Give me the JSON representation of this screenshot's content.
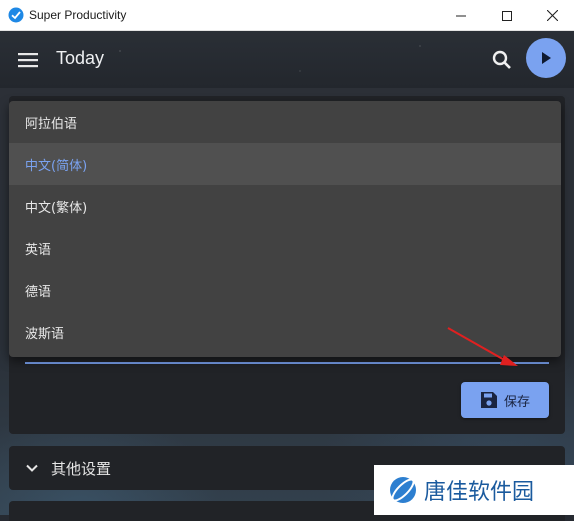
{
  "window": {
    "title": "Super Productivity"
  },
  "header": {
    "title": "Today"
  },
  "language_select": {
    "options": [
      "阿拉伯语",
      "中文(简体)",
      "中文(繁体)",
      "英语",
      "德语",
      "波斯语"
    ],
    "selected": "中文(简体)"
  },
  "actions": {
    "save_label": "保存"
  },
  "sections": {
    "other_settings_label": "其他设置"
  },
  "watermark": {
    "text": "唐佳软件园"
  },
  "colors": {
    "accent": "#7aa2f0",
    "dropdown_bg": "#424242",
    "card_bg": "#212327",
    "annotation_arrow": "#e02020"
  },
  "icons": [
    "app-logo-icon",
    "minimize-icon",
    "maximize-icon",
    "close-icon",
    "menu-icon",
    "search-icon",
    "play-icon",
    "save-icon",
    "chevron-down-icon",
    "watermark-logo-icon"
  ]
}
